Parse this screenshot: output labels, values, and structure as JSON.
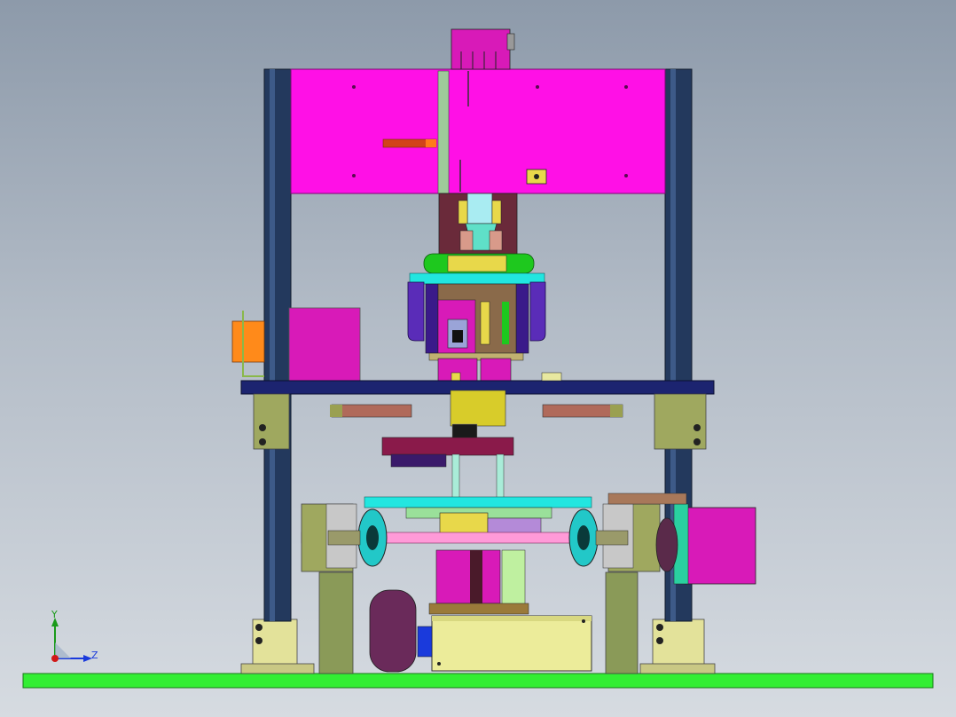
{
  "viewport": {
    "background_top": "#8d9aaa",
    "background_bottom": "#d6dbe1"
  },
  "triad": {
    "y_label": "Y",
    "z_label": "Z",
    "y_color": "#1a9a1a",
    "z_color": "#1a3adc",
    "origin_color": "#d01818"
  },
  "model": {
    "colors": {
      "base_plate": "#33ee33",
      "column": "#23395d",
      "top_housing": "#ff10e6",
      "mid_plate": "#1c2470",
      "bracket_olive": "#9fa85f",
      "cyan": "#22e6e0",
      "green_ring": "#1ec81e",
      "purple": "#5a2cb8",
      "motor_magenta": "#d81ab8",
      "beige_box": "#ecec9a",
      "maroon_drum": "#6a2a5a"
    }
  }
}
